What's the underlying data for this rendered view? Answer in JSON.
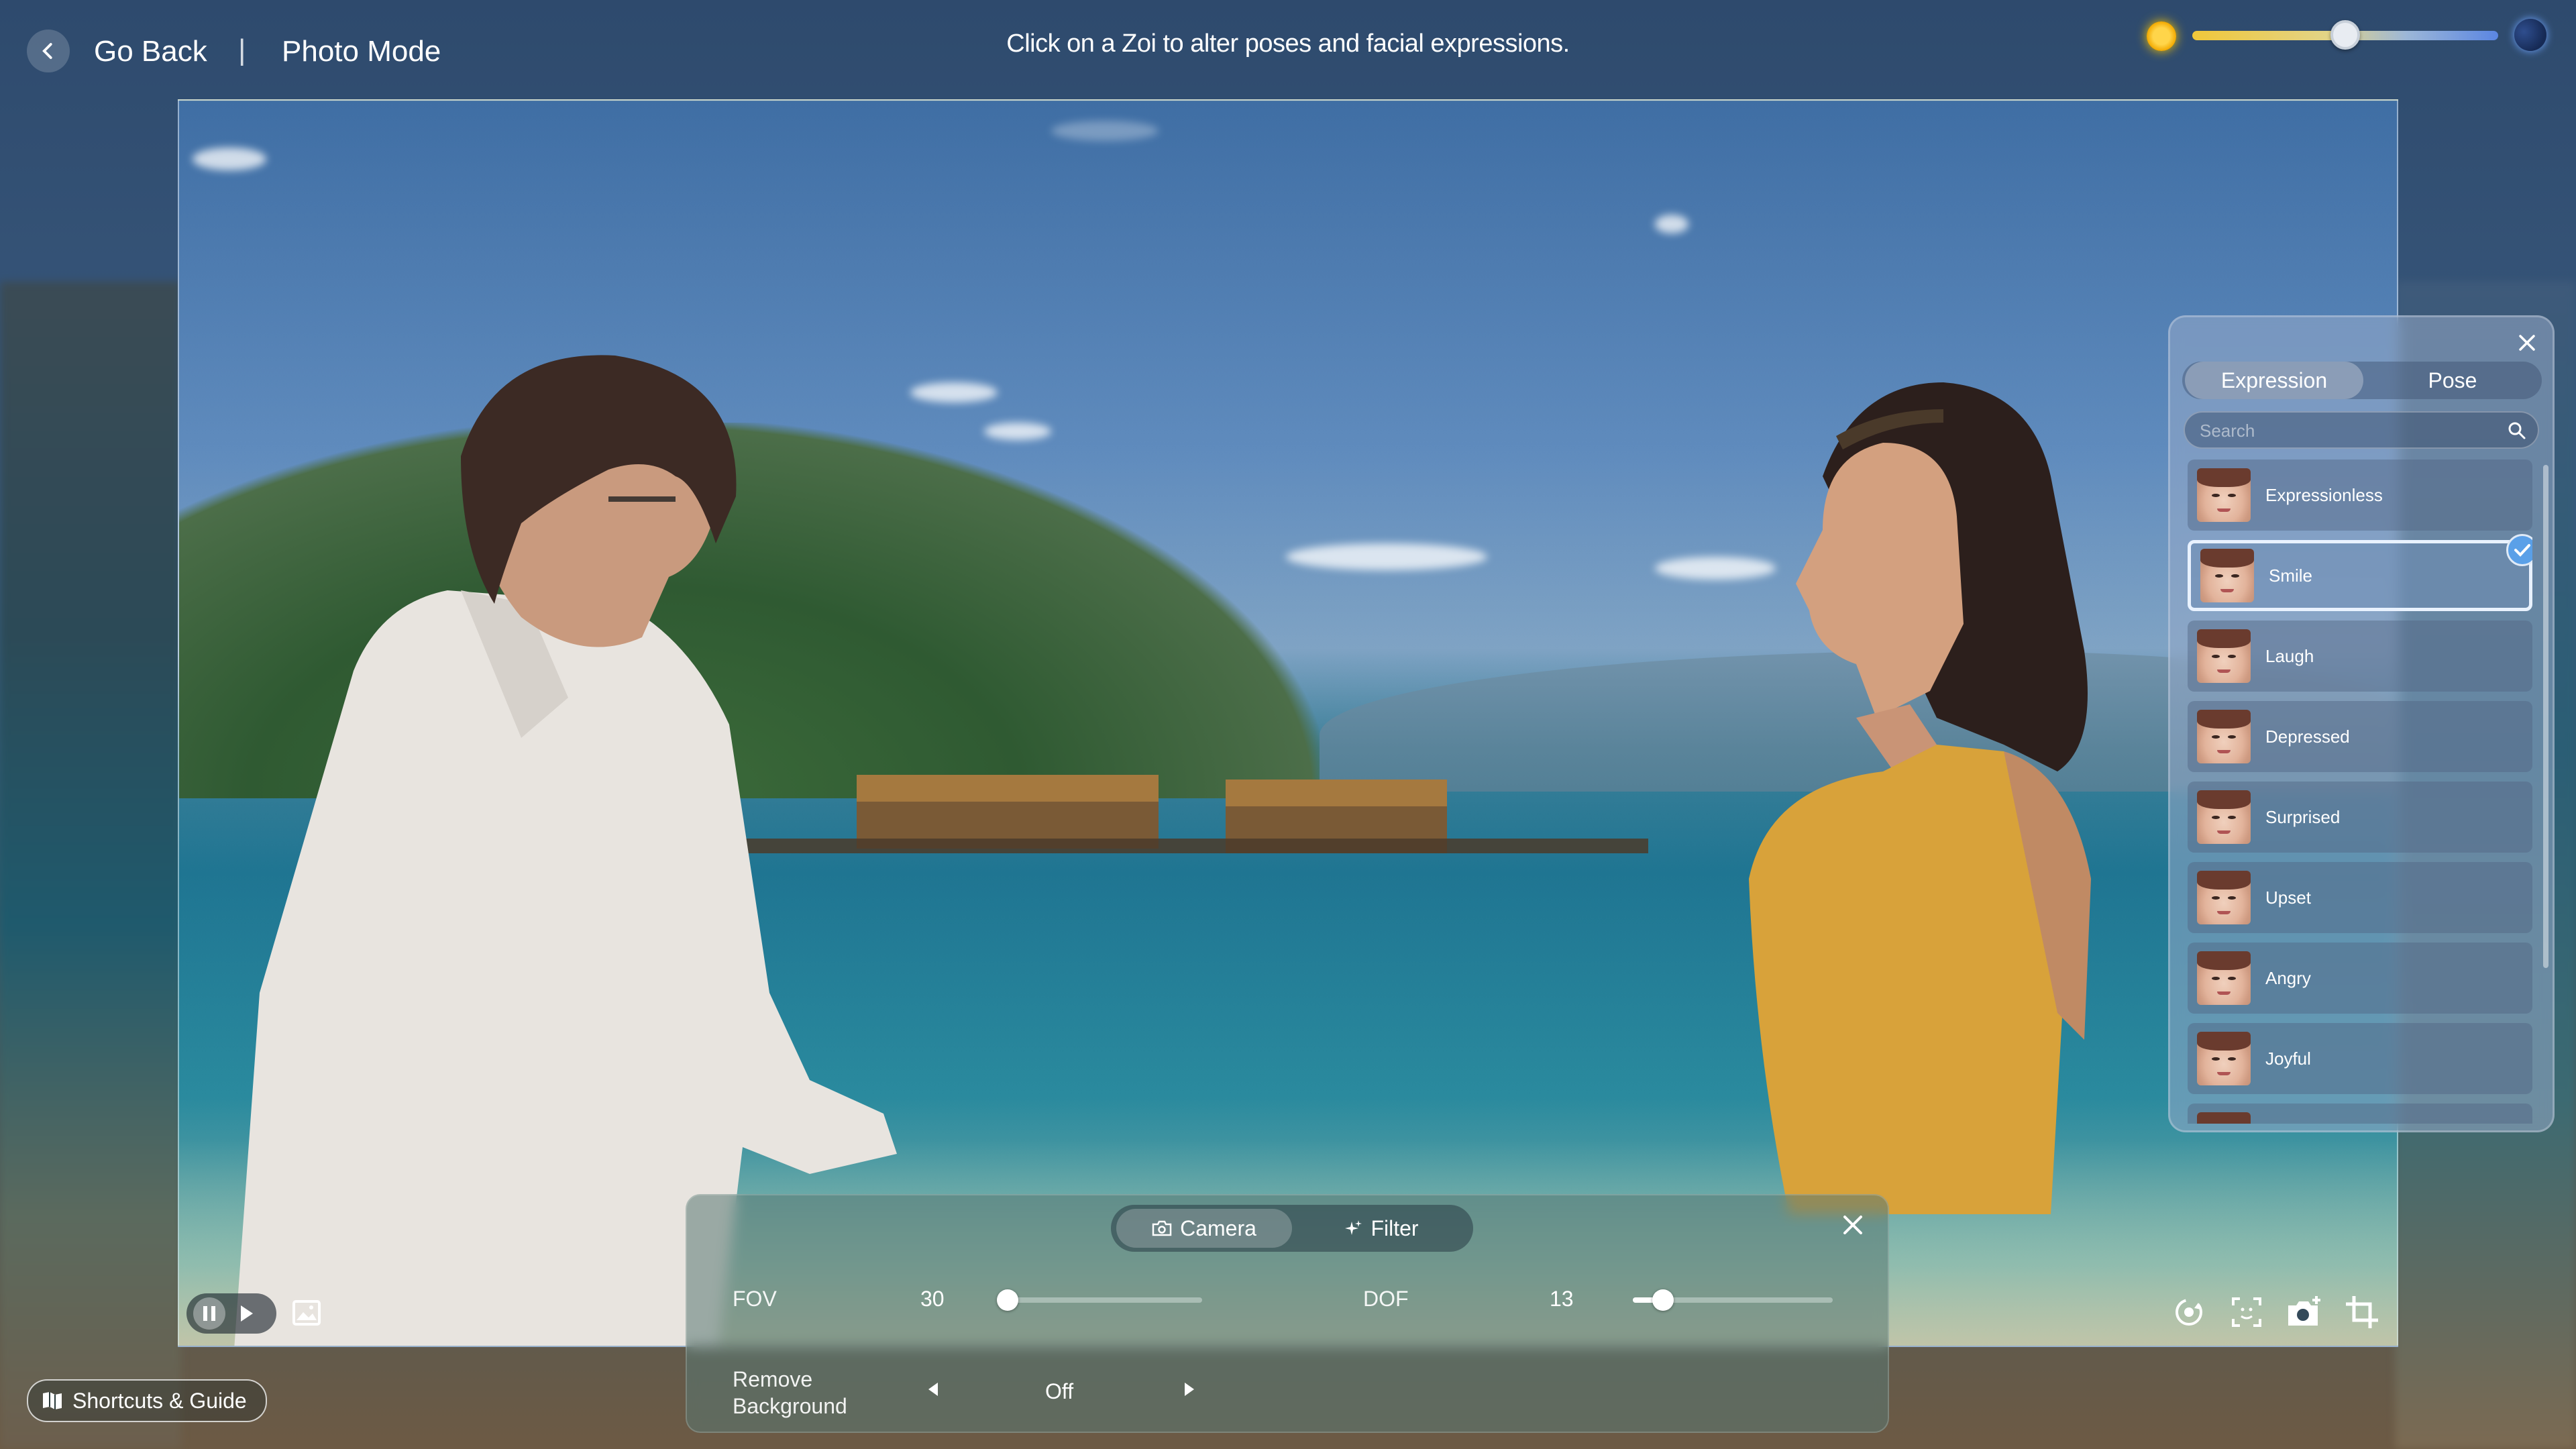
{
  "header": {
    "back_label": "Go Back",
    "separator": "|",
    "mode_title": "Photo Mode",
    "hint": "Click on a Zoi to alter poses and facial expressions."
  },
  "time_of_day": {
    "level": 0.5,
    "start_icon": "sun-icon",
    "end_icon": "moon-icon"
  },
  "camera_panel": {
    "tabs": [
      {
        "label": "Camera",
        "icon": "camera-icon",
        "active": true
      },
      {
        "label": "Filter",
        "icon": "sparkle-icon",
        "active": false
      }
    ],
    "fov": {
      "label": "FOV",
      "value": "30",
      "level": 0.0
    },
    "dof": {
      "label": "DOF",
      "value": "13",
      "level": 0.15
    },
    "remove_bg": {
      "label_line1": "Remove",
      "label_line2": "Background",
      "value": "Off"
    }
  },
  "shortcuts": {
    "label": "Shortcuts & Guide"
  },
  "expression_panel": {
    "tabs": [
      {
        "label": "Expression",
        "active": true
      },
      {
        "label": "Pose",
        "active": false
      }
    ],
    "search_placeholder": "Search",
    "items": [
      {
        "label": "Expressionless",
        "selected": false
      },
      {
        "label": "Smile",
        "selected": true
      },
      {
        "label": "Laugh",
        "selected": false
      },
      {
        "label": "Depressed",
        "selected": false
      },
      {
        "label": "Surprised",
        "selected": false
      },
      {
        "label": "Upset",
        "selected": false
      },
      {
        "label": "Angry",
        "selected": false
      },
      {
        "label": "Joyful",
        "selected": false
      }
    ]
  },
  "colors": {
    "accent": "#5aa0e8",
    "sun": "#f5c400",
    "moon": "#6fa4ff"
  }
}
